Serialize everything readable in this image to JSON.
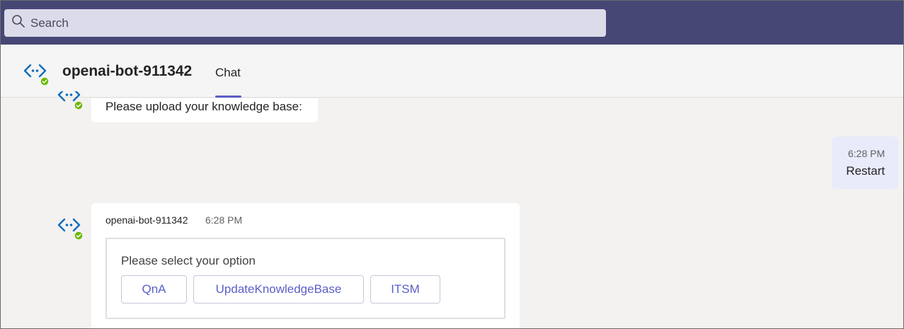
{
  "search": {
    "placeholder": "Search"
  },
  "header": {
    "bot_name": "openai-bot-911342",
    "tab_label": "Chat"
  },
  "messages": {
    "bot_message_1": {
      "text": "Please upload your knowledge base:"
    },
    "user_message": {
      "time": "6:28 PM",
      "text": "Restart"
    },
    "bot_card": {
      "sender": "openai-bot-911342",
      "time": "6:28 PM",
      "prompt": "Please select your option",
      "buttons": [
        "QnA",
        "UpdateKnowledgeBase",
        "ITSM"
      ]
    }
  },
  "icons": {
    "search": "search-icon",
    "bot_avatar": "bot-avatar-icon",
    "status": "available-status-icon"
  },
  "colors": {
    "topbar": "#464775",
    "accent": "#5b5fc7",
    "status_green": "#6bb700",
    "bot_logo_blue": "#0f6cbd"
  }
}
